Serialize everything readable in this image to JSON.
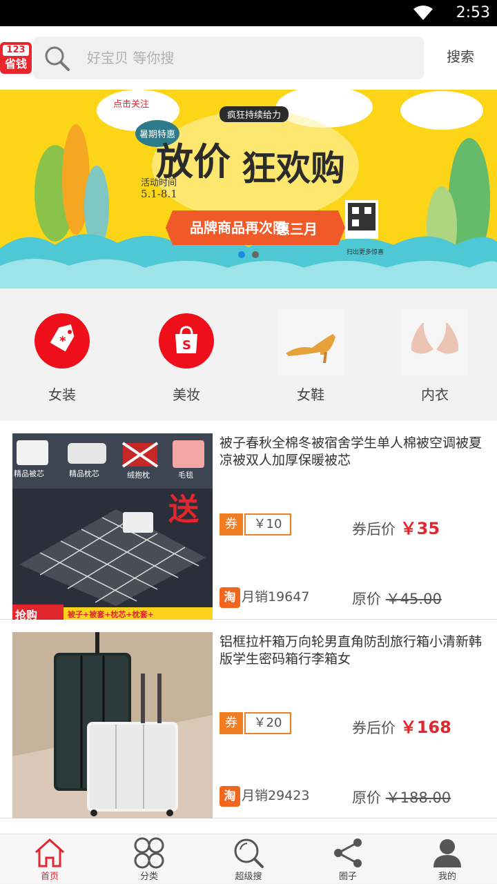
{
  "status_bar": {
    "time": "2:53"
  },
  "header": {
    "logo_top": "123",
    "logo_bottom": "省钱",
    "search_placeholder": "好宝贝 等你搜",
    "search_button": "搜索"
  },
  "banner": {
    "follow_tag": "点击关注",
    "subtitle": "疯狂持续给力",
    "badge": "暑期特惠",
    "title_1": "放价",
    "title_2": "狂欢购",
    "date_label": "活动时间",
    "date_range": "5.1-8.1",
    "ribbon_text": "品牌商品再次限",
    "ribbon_highlight": "惠三月",
    "qr_caption": "扫出更多惊喜"
  },
  "categories": [
    {
      "label": "女装",
      "icon": "tag-icon"
    },
    {
      "label": "美妆",
      "icon": "shopping-bag-icon"
    },
    {
      "label": "女鞋",
      "icon": "high-heel-photo"
    },
    {
      "label": "内衣",
      "icon": "bra-photo"
    }
  ],
  "products": [
    {
      "title": "被子春秋全棉冬被宿舍学生单人棉被空调被夏凉被双人加厚保暖被芯",
      "coupon_tag": "券",
      "coupon_amount": "￥10",
      "after_label": "券后价",
      "after_price": "￥35",
      "platform": "淘",
      "sales": "月销19647",
      "orig_label": "原价",
      "orig_price": "￥45.00",
      "thumb_labels": [
        "精品被芯",
        "精品枕芯",
        "绒抱枕",
        "毛毯",
        "送",
        "抢购",
        "被子+被套+枕芯+枕套+"
      ]
    },
    {
      "title": "铝框拉杆箱万向轮男直角防刮旅行箱小清新韩版学生密码箱行李箱女",
      "coupon_tag": "券",
      "coupon_amount": "￥20",
      "after_label": "券后价",
      "after_price": "￥168",
      "platform": "淘",
      "sales": "月销29423",
      "orig_label": "原价",
      "orig_price": "￥188.00"
    }
  ],
  "tabs": [
    {
      "label": "首页",
      "icon": "home-icon",
      "active": true
    },
    {
      "label": "分类",
      "icon": "category-grid-icon",
      "active": false
    },
    {
      "label": "超级搜",
      "icon": "search-icon",
      "active": false
    },
    {
      "label": "圈子",
      "icon": "share-icon",
      "active": false
    },
    {
      "label": "我的",
      "icon": "user-icon",
      "active": false
    }
  ],
  "colors": {
    "accent": "#e2262d",
    "coupon": "#f07d1f",
    "banner_bg": "#fcd418"
  }
}
